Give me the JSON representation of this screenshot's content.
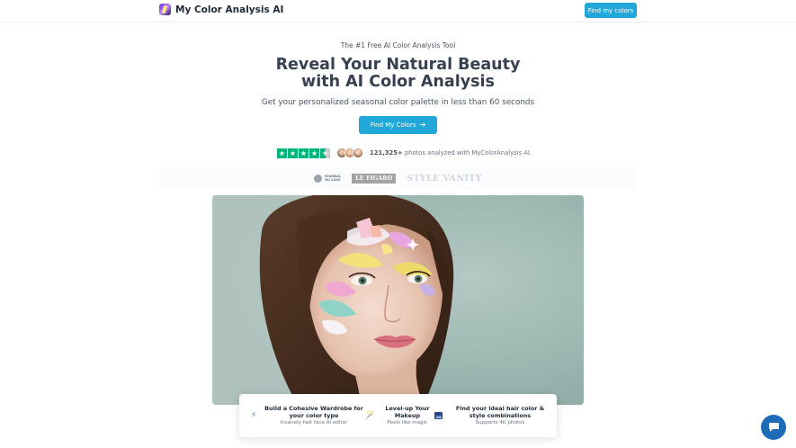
{
  "brand": {
    "name": "My Color Analysis AI",
    "logo_icon": "palette-logo-icon"
  },
  "nav": {
    "cta_label": "Find my colors"
  },
  "hero": {
    "eyebrow": "The #1 Free AI Color Analysis Tool",
    "headline_line1": "Reveal Your Natural Beauty",
    "headline_line2": "with AI Color Analysis",
    "subheadline": "Get your personalized seasonal color palette in less than 60 seconds",
    "cta_label": "Find My Colors",
    "cta_icon": "arrow-right-icon"
  },
  "social_proof": {
    "rating_stars": 4.5,
    "count": "121,325+",
    "text": "photos analyzed with MyColorAnalysis AI."
  },
  "press": {
    "journal_du_luxe_line1": "JOURNAL",
    "journal_du_luxe_line2": "DU LUXE",
    "le_figaro": "LE FIGARO",
    "style_vanity": "STYLE VANITY"
  },
  "features": [
    {
      "icon": "lightning-icon",
      "title_line1": "Build a Cohesive Wardrobe for",
      "title_line2": "your color type",
      "subtitle": "Insanely fast face AI editor"
    },
    {
      "icon": "magic-wand-icon",
      "title_line1": "Level-up Your",
      "title_line2": "Makeup",
      "subtitle": "Feels like magic"
    },
    {
      "icon": "image-icon",
      "title_line1": "Find your ideal hair color &",
      "title_line2": "style combinations",
      "subtitle": "Supports 4K photos"
    }
  ],
  "colors": {
    "accent": "#22a7d9",
    "trustpilot_green": "#00b67a",
    "chat": "#1e6bb8",
    "heading": "#374151"
  },
  "chat": {
    "icon": "chat-bubble-icon"
  }
}
